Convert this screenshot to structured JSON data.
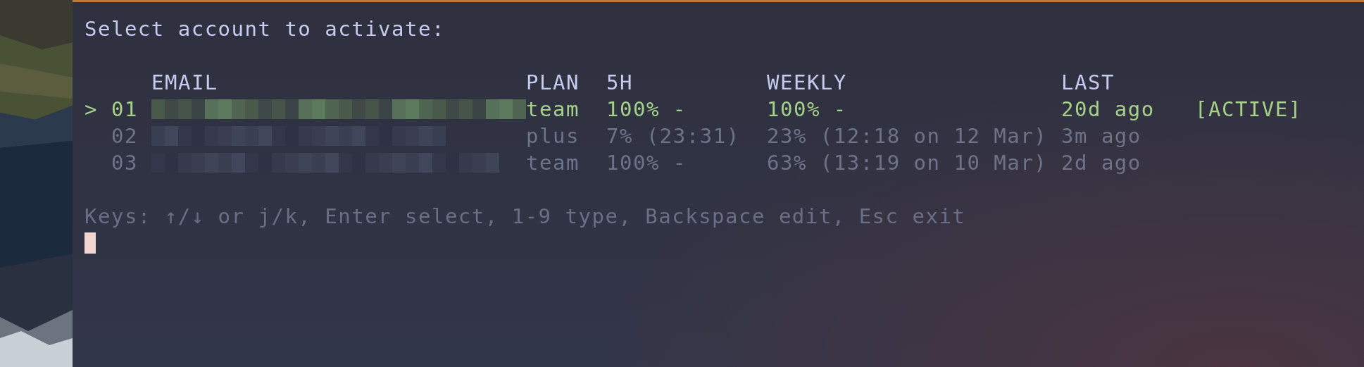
{
  "prompt": "Select account to activate:",
  "columns": [
    "EMAIL",
    "PLAN",
    "5H",
    "WEEKLY",
    "LAST"
  ],
  "pointer": ">",
  "rows": [
    {
      "selected": true,
      "number": "01",
      "plan": "team",
      "five_hour": "100% -",
      "weekly": "100% -",
      "last": "20d ago",
      "badge": "[ACTIVE]"
    },
    {
      "selected": false,
      "number": "02",
      "plan": "plus",
      "five_hour": "7% (23:31)",
      "weekly": "23% (12:18 on 12 Mar)",
      "last": "3m ago"
    },
    {
      "selected": false,
      "number": "03",
      "plan": "team",
      "five_hour": "100% -",
      "weekly": "63% (13:19 on 10 Mar)",
      "last": "2d ago"
    }
  ],
  "hint": "Keys: ↑/↓ or j/k, Enter select, 1-9 type, Backspace edit, Esc exit"
}
